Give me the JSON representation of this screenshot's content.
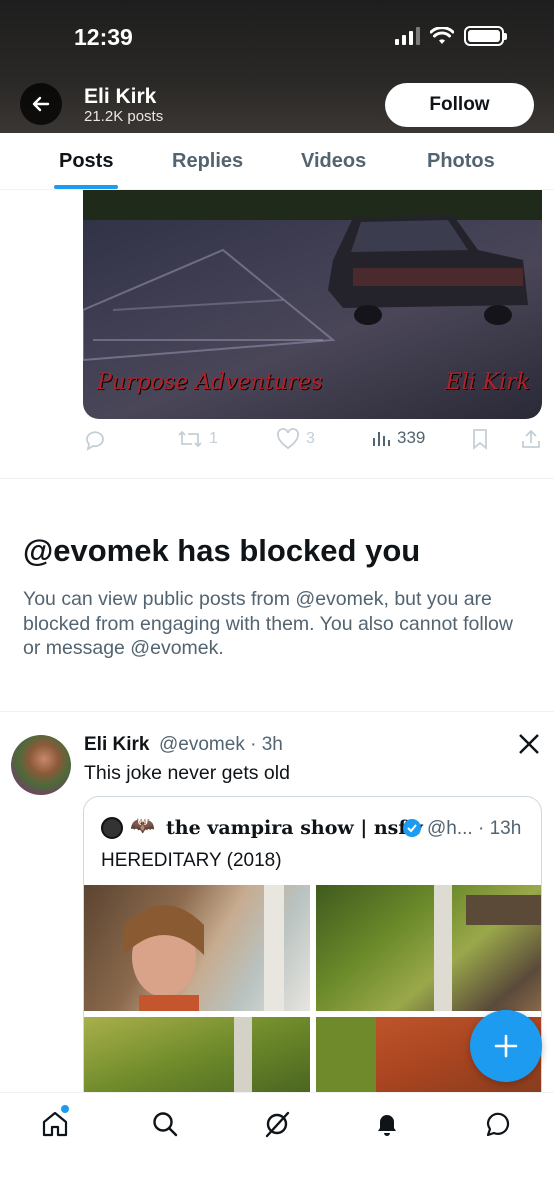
{
  "status_bar": {
    "time": "12:39"
  },
  "profile": {
    "name": "Eli Kirk",
    "posts_count": "21.2K posts",
    "follow_label": "Follow"
  },
  "tabs": [
    {
      "label": "Posts",
      "active": true
    },
    {
      "label": "Replies",
      "active": false
    },
    {
      "label": "Videos",
      "active": false
    },
    {
      "label": "Photos",
      "active": false
    }
  ],
  "previous_post": {
    "watermark_left": "Purpose Adventures",
    "watermark_right": "Eli Kirk",
    "reposts": "1",
    "likes": "3",
    "views": "339"
  },
  "blocked": {
    "title": "@evomek has blocked you",
    "message": "You can view public posts from @evomek, but you are blocked from engaging with them. You also cannot follow or message @evomek."
  },
  "tweet": {
    "author_name": "Eli Kirk",
    "handle_time": "@evomek · 3h",
    "text": "This joke never gets old",
    "quote": {
      "name": "the vampira show | nsfw",
      "handle_time": "@h... · 13h",
      "text": "HEREDITARY (2018)"
    }
  },
  "colors": {
    "accent": "#1d9bf0",
    "text_primary": "#0f1419",
    "text_secondary": "#536471"
  },
  "icons": {
    "back": "arrow-left-icon",
    "compose": "plus-icon",
    "nav": [
      "home-icon",
      "search-icon",
      "grok-icon",
      "notifications-icon",
      "messages-icon"
    ]
  }
}
